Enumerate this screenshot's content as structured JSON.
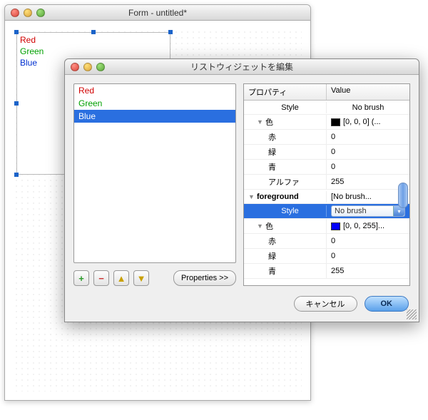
{
  "form": {
    "title": "Form - untitled*",
    "items": [
      {
        "label": "Red",
        "color": "#d10000"
      },
      {
        "label": "Green",
        "color": "#00a000"
      },
      {
        "label": "Blue",
        "color": "#0030d0"
      }
    ]
  },
  "dialog": {
    "title": "リストウィジェットを編集",
    "items": [
      {
        "label": "Red",
        "color": "#d10000",
        "selected": false
      },
      {
        "label": "Green",
        "color": "#00a000",
        "selected": false
      },
      {
        "label": "Blue",
        "color": "#ffffff",
        "selected": true
      }
    ],
    "toolbar": {
      "add": "+",
      "remove": "−",
      "up": "▲",
      "down": "▼",
      "properties": "Properties >>"
    },
    "headers": {
      "property": "プロパティ",
      "value": "Value"
    },
    "rows": [
      {
        "k": "Style",
        "v": "No brush",
        "indent": 1,
        "center": true
      },
      {
        "k": "色",
        "v": "[0, 0, 0] (...",
        "indent": 1,
        "disc": "▼",
        "swatch": "#000000"
      },
      {
        "k": "赤",
        "v": "0",
        "indent": 2
      },
      {
        "k": "緑",
        "v": "0",
        "indent": 2
      },
      {
        "k": "青",
        "v": "0",
        "indent": 2
      },
      {
        "k": "アルファ",
        "v": "255",
        "indent": 2
      },
      {
        "k": "foreground",
        "v": "[No brush...",
        "indent": 0,
        "disc": "▼",
        "bold": true
      },
      {
        "k": "Style",
        "v": "No brush",
        "indent": 1,
        "selected": true,
        "combo": true,
        "center": true
      },
      {
        "k": "色",
        "v": "[0, 0, 255]...",
        "indent": 1,
        "disc": "▼",
        "swatch": "#0000ff"
      },
      {
        "k": "赤",
        "v": "0",
        "indent": 2
      },
      {
        "k": "緑",
        "v": "0",
        "indent": 2
      },
      {
        "k": "青",
        "v": "255",
        "indent": 2
      }
    ],
    "buttons": {
      "cancel": "キャンセル",
      "ok": "OK"
    }
  }
}
